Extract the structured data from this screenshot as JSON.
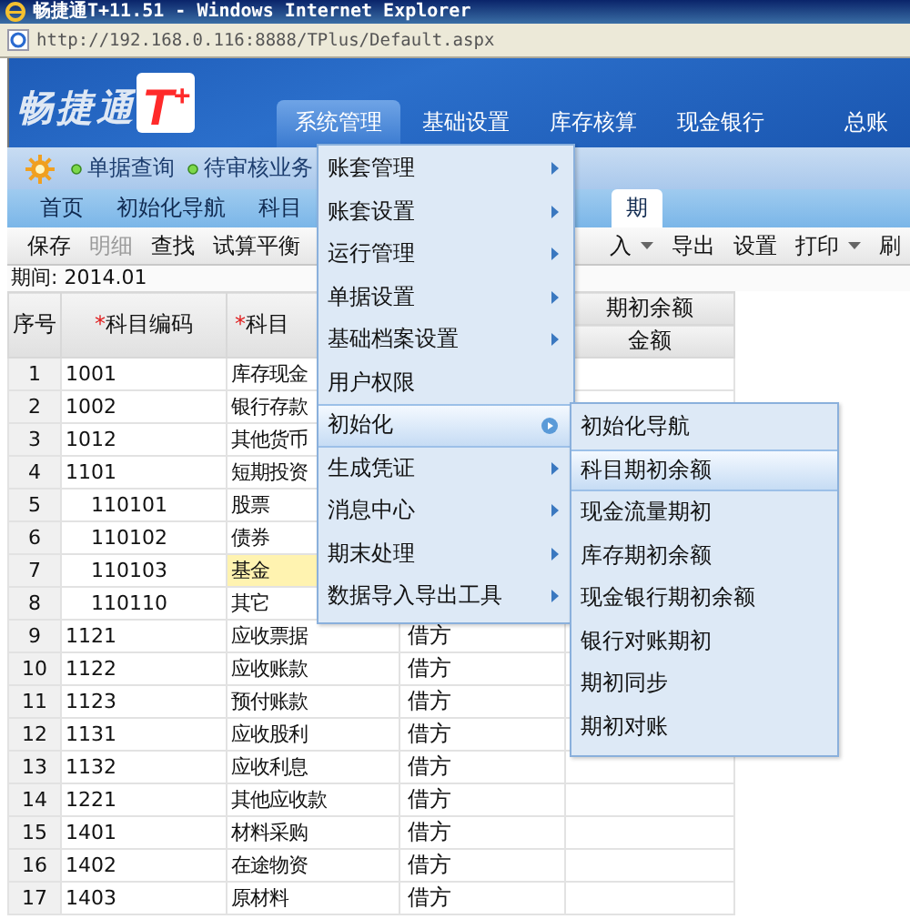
{
  "window": {
    "title": "畅捷通T+11.51 - Windows Internet Explorer"
  },
  "address_bar": {
    "url": "http://192.168.0.116:8888/TPlus/Default.aspx"
  },
  "logo": {
    "text": "畅捷通",
    "mark": "T$^{+}$"
  },
  "nav": [
    {
      "label": "系统管理",
      "selected": true
    },
    {
      "label": "基础设置",
      "selected": false
    },
    {
      "label": "库存核算",
      "selected": false
    },
    {
      "label": "现金银行",
      "selected": false
    },
    {
      "label": "总账",
      "selected": false
    }
  ],
  "quick_links": [
    {
      "label": "单据查询"
    },
    {
      "label": "待审核业务"
    }
  ],
  "tabs": [
    {
      "label": "首页",
      "selected": false
    },
    {
      "label": "初始化导航",
      "selected": false
    },
    {
      "label": "科目",
      "selected": false
    },
    {
      "label": "期",
      "selected": true
    }
  ],
  "toolbar": [
    {
      "label": "保存",
      "disabled": false,
      "dropdown": false
    },
    {
      "label": "明细",
      "disabled": true,
      "dropdown": false
    },
    {
      "label": "查找",
      "disabled": false,
      "dropdown": false
    },
    {
      "label": "试算平衡",
      "disabled": false,
      "dropdown": false
    }
  ],
  "toolbar_right": [
    {
      "label": "入",
      "disabled": false,
      "dropdown": true
    },
    {
      "label": "导出",
      "disabled": false,
      "dropdown": false
    },
    {
      "label": "设置",
      "disabled": false,
      "dropdown": false
    },
    {
      "label": "打印",
      "disabled": false,
      "dropdown": true
    },
    {
      "label": "刷",
      "disabled": false,
      "dropdown": false
    }
  ],
  "period": "期间: 2014.01",
  "table": {
    "columns": [
      {
        "label": "序号"
      },
      {
        "label": "科目编码",
        "mark": "*"
      },
      {
        "label": "科目",
        "mark": "*"
      },
      {
        "group": "期初余额",
        "label": "金额"
      }
    ],
    "rows": [
      {
        "no": "1",
        "code": "1001",
        "name": "库存现金",
        "selected": false
      },
      {
        "no": "2",
        "code": "1002",
        "name": "银行存款",
        "selected": false
      },
      {
        "no": "3",
        "code": "1012",
        "name": "其他货币",
        "selected": false
      },
      {
        "no": "4",
        "code": "1101",
        "name": "短期投资",
        "selected": false,
        "children": [
          {
            "no": "5",
            "code": "110101",
            "name": "股票",
            "selected": false
          },
          {
            "no": "6",
            "code": "110102",
            "name": "债券",
            "selected": false
          },
          {
            "no": "7",
            "code": "110103",
            "name": "基金",
            "selected": true
          },
          {
            "no": "8",
            "code": "110110",
            "name": "其它",
            "selected": false
          }
        ]
      },
      {
        "no": "9",
        "code": "1121",
        "name": "应收票据",
        "direction": "借方",
        "selected": false
      },
      {
        "no": "10",
        "code": "1122",
        "name": "应收账款",
        "direction": "借方",
        "selected": false
      },
      {
        "no": "11",
        "code": "1123",
        "name": "预付账款",
        "direction": "借方",
        "selected": false
      },
      {
        "no": "12",
        "code": "1131",
        "name": "应收股利",
        "direction": "借方",
        "selected": false
      },
      {
        "no": "13",
        "code": "1132",
        "name": "应收利息",
        "direction": "借方",
        "selected": false
      },
      {
        "no": "14",
        "code": "1221",
        "name": "其他应收款",
        "direction": "借方",
        "selected": false
      },
      {
        "no": "15",
        "code": "1401",
        "name": "材料采购",
        "direction": "借方",
        "selected": false
      },
      {
        "no": "16",
        "code": "1402",
        "name": "在途物资",
        "direction": "借方",
        "selected": false
      },
      {
        "no": "17",
        "code": "1403",
        "name": "原材料",
        "direction": "借方",
        "selected": false
      }
    ]
  },
  "menu": {
    "items": [
      {
        "label": "账套管理",
        "submenu": true,
        "selected": false
      },
      {
        "label": "账套设置",
        "submenu": true,
        "selected": false
      },
      {
        "label": "运行管理",
        "submenu": true,
        "selected": false
      },
      {
        "label": "单据设置",
        "submenu": true,
        "selected": false
      },
      {
        "label": "基础档案设置",
        "submenu": true,
        "selected": false
      },
      {
        "label": "用户权限",
        "submenu": false,
        "selected": false
      },
      {
        "label": "初始化",
        "submenu": true,
        "selected": true
      },
      {
        "label": "生成凭证",
        "submenu": true,
        "selected": false
      },
      {
        "label": "消息中心",
        "submenu": true,
        "selected": false
      },
      {
        "label": "期末处理",
        "submenu": true,
        "selected": false
      },
      {
        "label": "数据导入导出工具",
        "submenu": true,
        "selected": false
      }
    ]
  },
  "submenu": {
    "items": [
      {
        "label": "初始化导航",
        "selected": false
      },
      {
        "label": "科目期初余额",
        "selected": true
      },
      {
        "label": "现金流量期初",
        "selected": false
      },
      {
        "label": "库存期初余额",
        "selected": false
      },
      {
        "label": "现金银行期初余额",
        "selected": false
      },
      {
        "label": "银行对账期初",
        "selected": false
      },
      {
        "label": "期初同步",
        "selected": false
      },
      {
        "label": "期初对账",
        "selected": false
      }
    ]
  }
}
